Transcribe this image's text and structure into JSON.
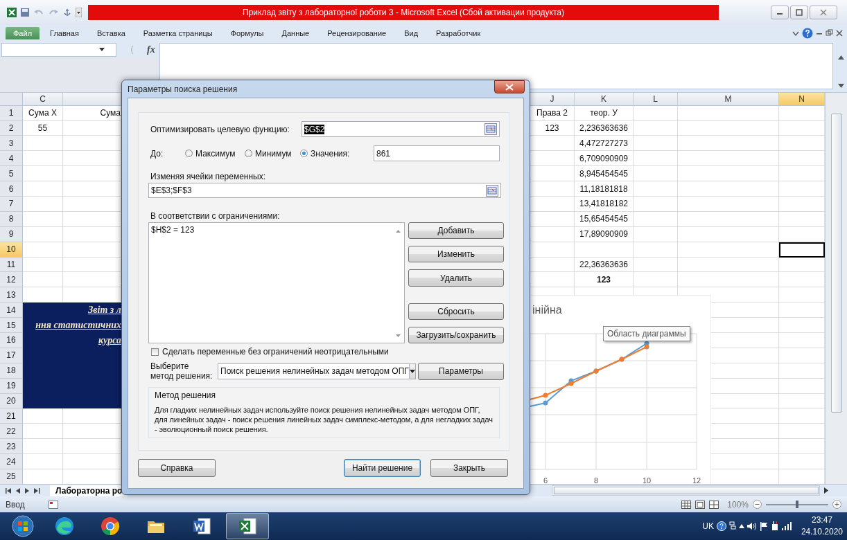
{
  "window": {
    "title": "Приклад звіту з лабораторної роботи 3  -  Microsoft Excel (Сбой активации продукта)"
  },
  "ribbon_tabs": [
    {
      "label": "Файл",
      "selected": true
    },
    {
      "label": "Главная",
      "selected": false
    },
    {
      "label": "Вставка",
      "selected": false
    },
    {
      "label": "Разметка страницы",
      "selected": false
    },
    {
      "label": "Формулы",
      "selected": false
    },
    {
      "label": "Данные",
      "selected": false
    },
    {
      "label": "Рецензирование",
      "selected": false
    },
    {
      "label": "Вид",
      "selected": false
    },
    {
      "label": "Разработчик",
      "selected": false
    }
  ],
  "formula_bar": {
    "fx": "fx"
  },
  "sheet": {
    "column_headers": {
      "c": {
        "label": "C",
        "selected": false
      },
      "j": {
        "label": "J",
        "selected": false
      },
      "k": {
        "label": "K",
        "selected": false
      },
      "l": {
        "label": "L",
        "selected": false
      },
      "m": {
        "label": "M",
        "selected": false
      },
      "n": {
        "label": "N",
        "selected": true
      }
    },
    "rows": [
      {
        "number": "1",
        "selected": false,
        "banner": false,
        "cells": {
          "c": "Сума X",
          "d": "Сума",
          "j": "Права 2",
          "k": "теор. У"
        }
      },
      {
        "number": "2",
        "selected": false,
        "banner": false,
        "cells": {
          "c": "55",
          "j": "123",
          "k": "2,236363636"
        }
      },
      {
        "number": "3",
        "selected": false,
        "banner": false,
        "cells": {
          "k": "4,472727273"
        }
      },
      {
        "number": "4",
        "selected": false,
        "banner": false,
        "cells": {
          "k": "6,709090909"
        }
      },
      {
        "number": "5",
        "selected": false,
        "banner": false,
        "cells": {
          "k": "8,945454545"
        }
      },
      {
        "number": "6",
        "selected": false,
        "banner": false,
        "cells": {
          "k": "11,18181818"
        }
      },
      {
        "number": "7",
        "selected": false,
        "banner": false,
        "cells": {
          "k": "13,41818182"
        }
      },
      {
        "number": "8",
        "selected": false,
        "banner": false,
        "cells": {
          "k": "15,65454545"
        }
      },
      {
        "number": "9",
        "selected": false,
        "banner": false,
        "cells": {
          "k": "17,89090909"
        }
      },
      {
        "number": "10",
        "selected": true,
        "banner": false,
        "cells": {}
      },
      {
        "number": "11",
        "selected": false,
        "banner": false,
        "cells": {
          "k": "22,36363636"
        }
      },
      {
        "number": "12",
        "selected": false,
        "banner": false,
        "bold": true,
        "cells": {
          "k": "123"
        }
      },
      {
        "number": "13",
        "selected": false,
        "banner": false,
        "cells": {}
      },
      {
        "number": "14",
        "selected": false,
        "banner": true,
        "cells": {
          "cd": "Звіт з л"
        }
      },
      {
        "number": "15",
        "selected": false,
        "banner": true,
        "cells": {
          "cd": "ння статистичних"
        }
      },
      {
        "number": "16",
        "selected": false,
        "banner": true,
        "cells": {
          "cd": "курса"
        }
      },
      {
        "number": "17",
        "selected": false,
        "banner": true,
        "cells": {}
      },
      {
        "number": "18",
        "selected": false,
        "banner": true,
        "cells": {}
      },
      {
        "number": "19",
        "selected": false,
        "banner": true,
        "cells": {}
      },
      {
        "number": "20",
        "selected": false,
        "banner": true,
        "cells": {}
      },
      {
        "number": "21",
        "selected": false,
        "banner": false,
        "cells": {}
      },
      {
        "number": "22",
        "selected": false,
        "banner": false,
        "cells": {}
      },
      {
        "number": "23",
        "selected": false,
        "banner": false,
        "cells": {}
      },
      {
        "number": "24",
        "selected": false,
        "banner": false,
        "cells": {}
      },
      {
        "number": "25",
        "selected": false,
        "banner": false,
        "cells": {}
      }
    ],
    "chart": {
      "title": "інійна",
      "tooltip": "Область диаграммы",
      "x_tick_labels": [
        "6",
        "8",
        "10",
        "12"
      ]
    },
    "sheet_tab": "Лабораторна ро"
  },
  "status_bar": {
    "mode": "Ввод",
    "zoom": {
      "label": "100%",
      "level": 0.5
    }
  },
  "taskbar": {
    "apps": [
      {
        "kind": "edge",
        "selected": false
      },
      {
        "kind": "chrome",
        "selected": false
      },
      {
        "kind": "folder",
        "selected": false
      },
      {
        "kind": "word",
        "selected": false
      },
      {
        "kind": "excel",
        "selected": true
      }
    ],
    "language": "UK",
    "time": "23:47",
    "date": "24.10.2020"
  },
  "dialog": {
    "title": "Параметры поиска решения",
    "objective": {
      "label": "Оптимизировать целевую функцию:",
      "value": "$G$2",
      "value_selected": true
    },
    "to_label": "До:",
    "to_options": [
      {
        "label": "Максимум",
        "selected": false
      },
      {
        "label": "Минимум",
        "selected": false
      },
      {
        "label": "Значения:",
        "selected": true
      }
    ],
    "target_value": "861",
    "variables": {
      "label": "Изменяя ячейки переменных:",
      "value": "$E$3;$F$3"
    },
    "constraints": {
      "label": "В соответствии с ограничениями:",
      "items": [
        "$H$2 = 123"
      ]
    },
    "side_buttons": [
      "Добавить",
      "Изменить",
      "Удалить",
      "Сбросить",
      "Загрузить/сохранить"
    ],
    "nonnegative": {
      "label": "Сделать переменные без ограничений неотрицательными",
      "checked": false
    },
    "method": {
      "label_lines": [
        "Выберите",
        "метод решения:"
      ],
      "value": "Поиск решения нелинейных задач методом ОПГ",
      "button": "Параметры"
    },
    "method_group": {
      "title": "Метод решения",
      "text": "Для гладких нелинейных задач используйте поиск решения нелинейных задач методом ОПГ, для линейных задач - поиск решения линейных задач симплекс-методом, а для негладких задач - эволюционный поиск решения."
    },
    "footer_buttons": [
      {
        "label": "Справка",
        "default": false
      },
      {
        "label": "Найти решение",
        "default": true
      },
      {
        "label": "Закрыть",
        "default": false
      }
    ]
  }
}
